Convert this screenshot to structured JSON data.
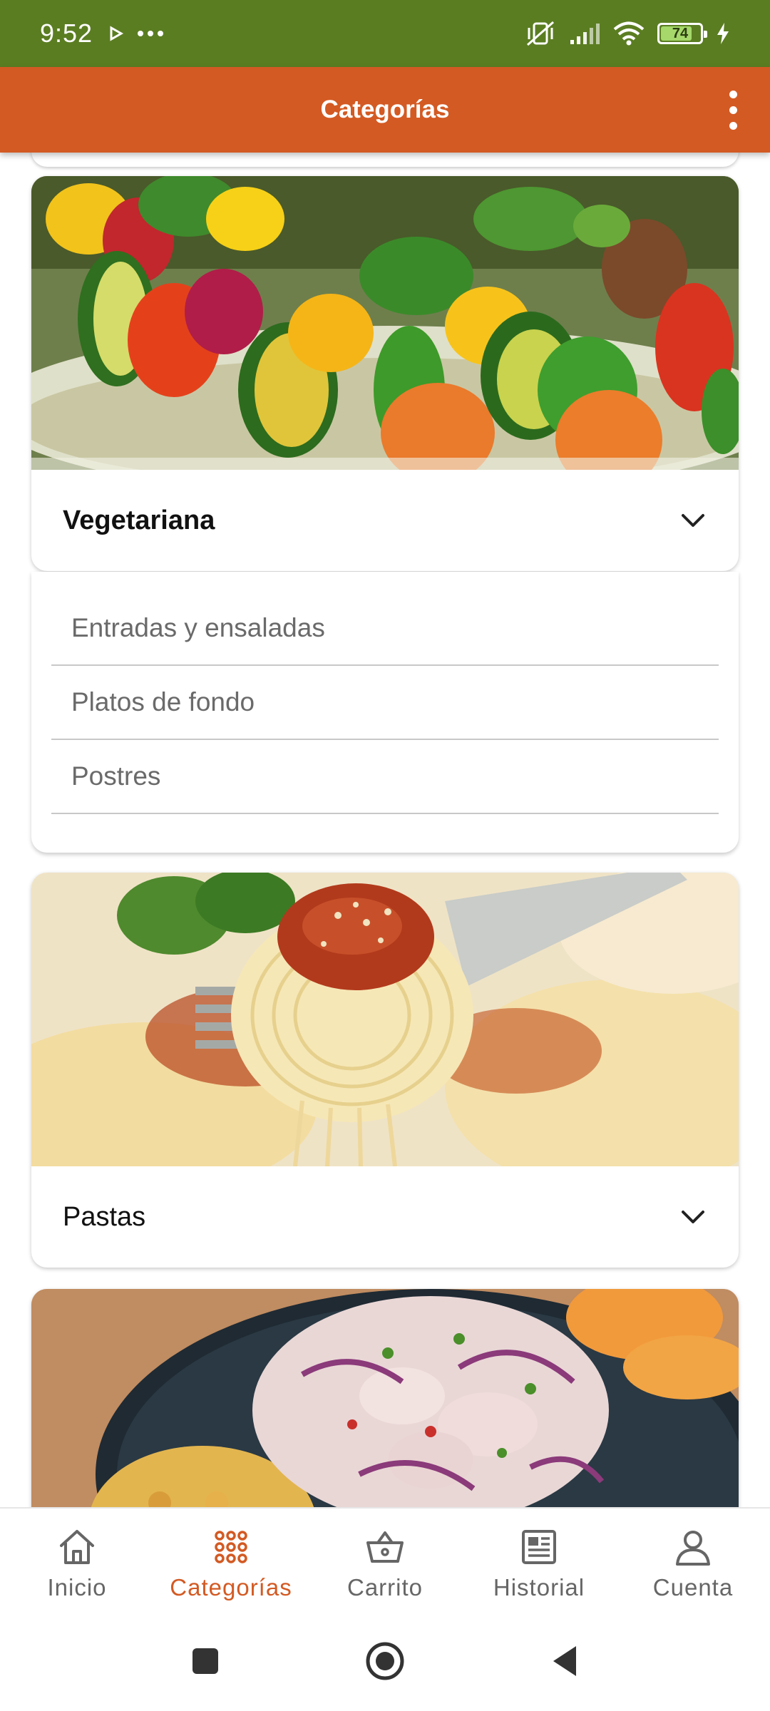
{
  "status_bar": {
    "time": "9:52",
    "battery": "74",
    "icons": [
      "play-icon",
      "more-dots-icon",
      "vibrate-off-icon",
      "signal-icon",
      "wifi-icon",
      "battery-icon",
      "charging-icon"
    ]
  },
  "app_bar": {
    "title": "Categorías",
    "menu_icon": "more-vert-icon"
  },
  "categories": [
    {
      "name": "Vegetariana",
      "expanded": true,
      "image": "vegetable-skewers",
      "subcategories": [
        "Entradas y ensaladas",
        "Platos de fondo",
        "Postres"
      ]
    },
    {
      "name": "Pastas",
      "expanded": false,
      "image": "spaghetti-fork"
    },
    {
      "image": "ceviche-plate"
    }
  ],
  "bottom_nav": {
    "items": [
      {
        "label": "Inicio",
        "icon": "home-icon",
        "active": false
      },
      {
        "label": "Categorías",
        "icon": "grid-dots-icon",
        "active": true
      },
      {
        "label": "Carrito",
        "icon": "basket-icon",
        "active": false
      },
      {
        "label": "Historial",
        "icon": "news-icon",
        "active": false
      },
      {
        "label": "Cuenta",
        "icon": "person-icon",
        "active": false
      }
    ]
  },
  "system_nav": [
    "recents-square-icon",
    "home-circle-icon",
    "back-triangle-icon"
  ],
  "colors": {
    "status_bar": "#5b7d22",
    "app_bar": "#d35a23",
    "accent": "#d35a23",
    "inactive_nav": "#666666"
  }
}
